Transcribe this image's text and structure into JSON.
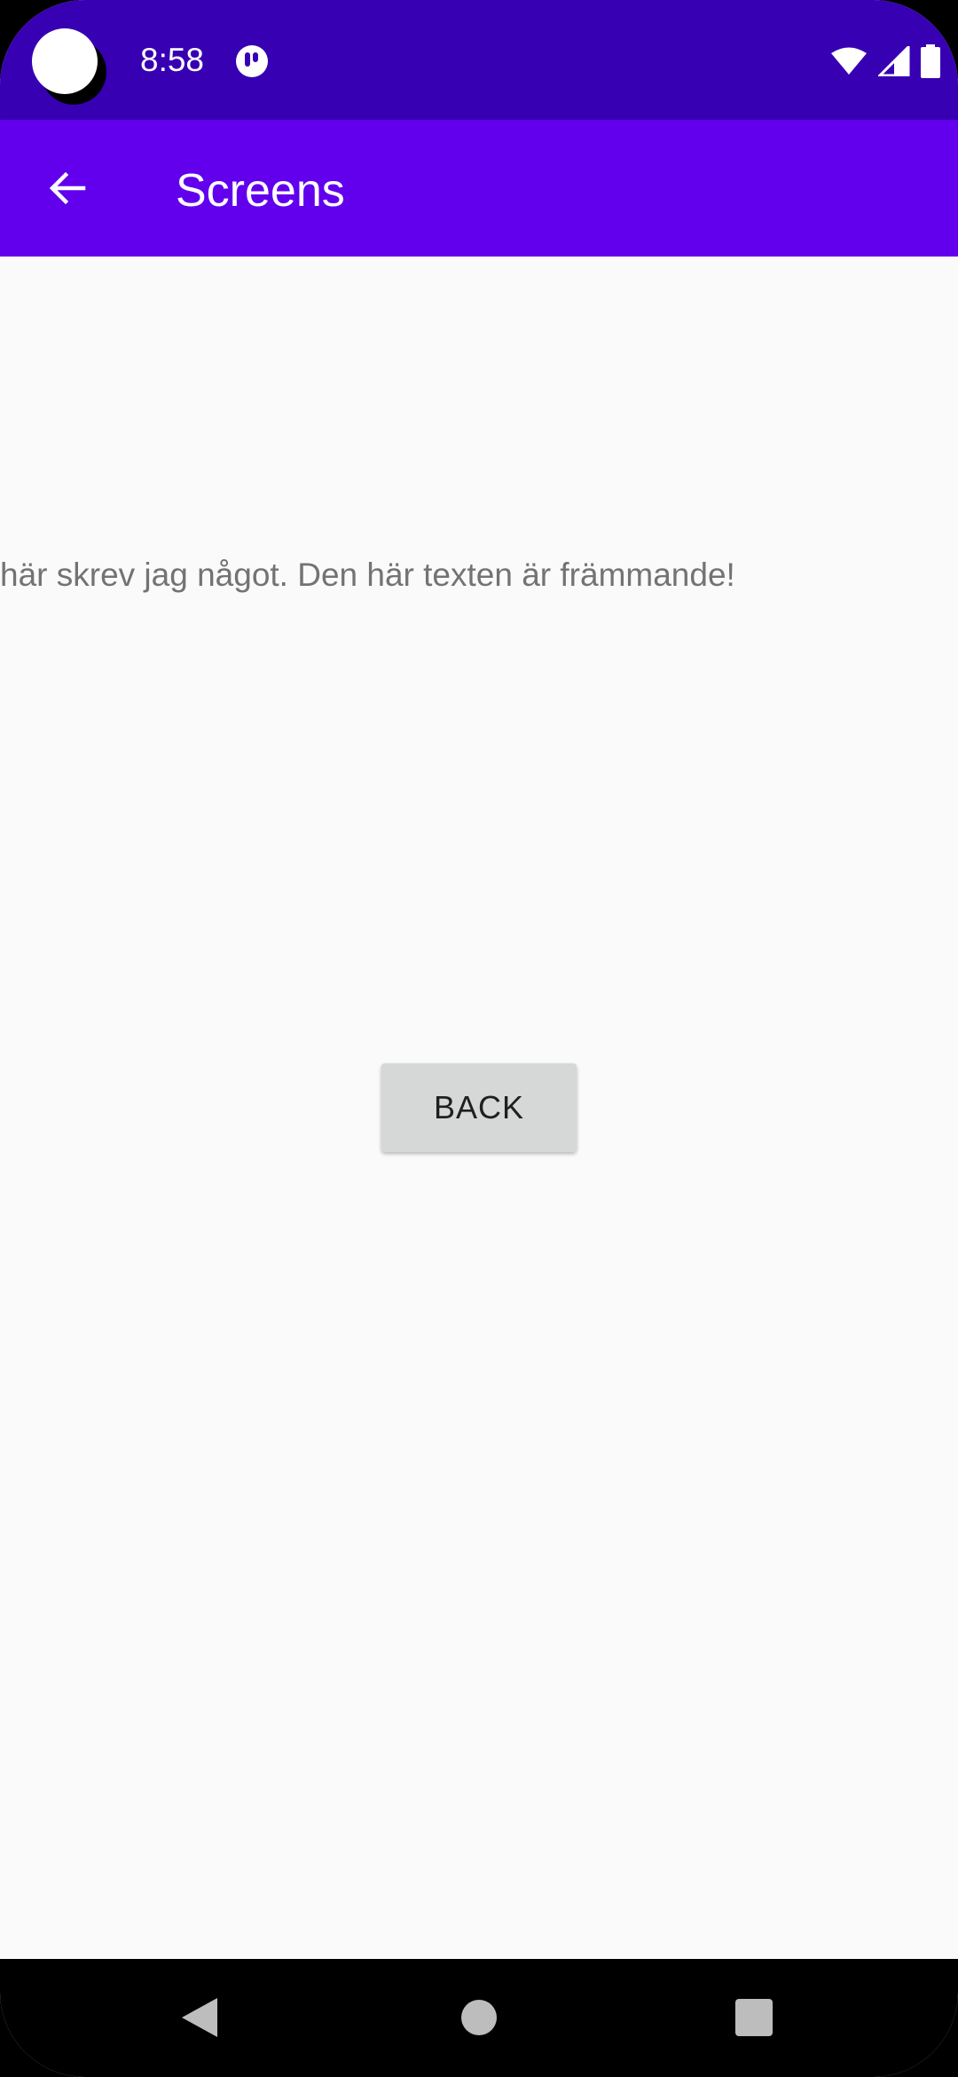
{
  "status_bar": {
    "time": "8:58",
    "camera_icon": "camera-cutout",
    "notification_icon": "app-notification-icon",
    "wifi_icon": "wifi-icon",
    "signal_icon": "cell-signal-icon",
    "battery_icon": "battery-icon",
    "background_color": "#3700b3"
  },
  "app_bar": {
    "title": "Screens",
    "nav_icon": "arrow-back-icon",
    "background_color": "#6200ee"
  },
  "main": {
    "message": "här skrev jag något. Den här texten är främmande!",
    "back_button_label": "BACK"
  },
  "nav_bar": {
    "back_icon": "nav-back-triangle-icon",
    "home_icon": "nav-home-circle-icon",
    "recents_icon": "nav-recents-square-icon"
  },
  "colors": {
    "screen_background": "#fafafa",
    "message_text": "#737373",
    "button_background": "#d6d7d7"
  }
}
